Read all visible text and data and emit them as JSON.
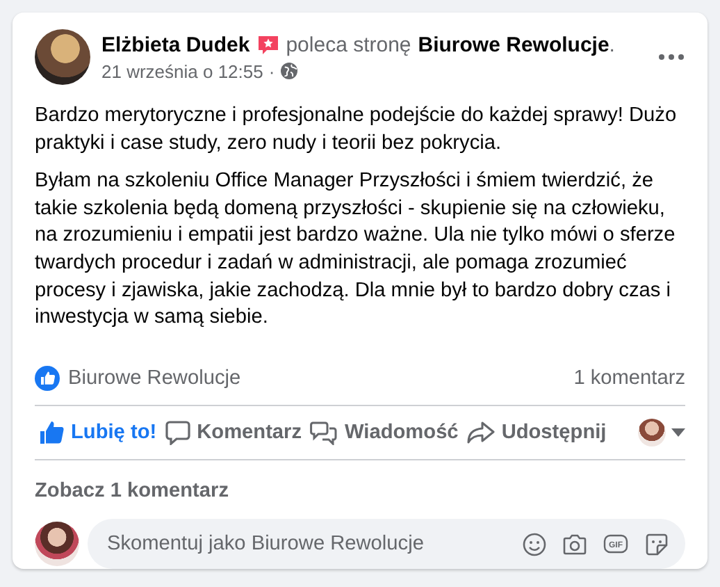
{
  "post": {
    "author": "Elżbieta Dudek",
    "action": "poleca stronę",
    "page": "Biurowe Rewolucje",
    "page_end": ".",
    "time": "21 września o 12:55",
    "separator": "·",
    "paragraphs": [
      "Bardzo merytoryczne i profesjonalne podejście do każdej sprawy! Dużo praktyki i case study, zero nudy i teorii bez pokrycia.",
      "Byłam na szkoleniu Office Manager Przyszłości i śmiem twierdzić, że takie szkolenia będą domeną przyszłości - skupienie się na człowieku, na zrozumieniu i empatii jest bardzo ważne. Ula nie tylko mówi o sferze twardych procedur i zadań w administracji, ale pomaga zrozumieć procesy i zjawiska, jakie zachodzą. Dla mnie był to bardzo dobry czas i inwestycja w samą siebie."
    ]
  },
  "reactions": {
    "names": "Biurowe Rewolucje",
    "comments": "1 komentarz"
  },
  "actions": [
    {
      "kind": "like",
      "label": "Lubię to!",
      "selected": true
    },
    {
      "kind": "comment",
      "label": "Komentarz",
      "selected": false
    },
    {
      "kind": "message",
      "label": "Wiadomość",
      "selected": false
    },
    {
      "kind": "share",
      "label": "Udostępnij",
      "selected": false
    }
  ],
  "see_comments": "Zobacz 1 komentarz",
  "comment_box": {
    "placeholder": "Skomentuj jako Biurowe Rewolucje",
    "gif_label": "GIF"
  }
}
